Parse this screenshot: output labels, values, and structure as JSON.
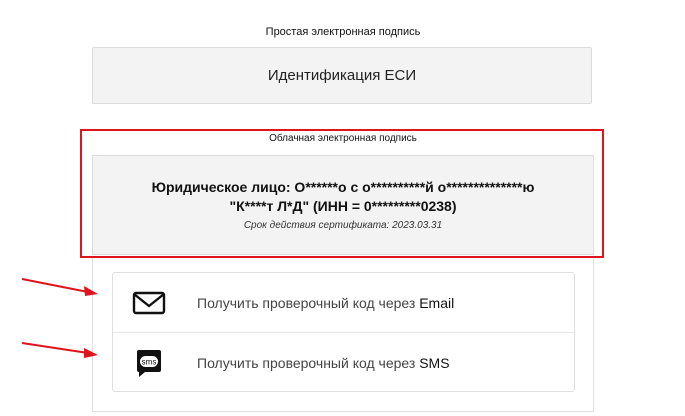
{
  "simple_signature": {
    "label": "Простая электронная подпись",
    "button_label": "Идентификация ЕСИ"
  },
  "cloud_signature": {
    "label": "Облачная электронная подпись",
    "cert_line_1": "Юридическое лицо: О******о с о**********й о**************ю",
    "cert_line_2": "\"К****т Л*Д\" (ИНН = 0*********0238)",
    "validity": "Срок действия сертификата: 2023.03.31"
  },
  "methods": {
    "email": {
      "prefix": "Получить проверочный код через ",
      "channel": "Email",
      "icon": "envelope-icon"
    },
    "sms": {
      "prefix": "Получить проверочный код через ",
      "channel": "SMS",
      "icon": "sms-icon",
      "icon_text": "sms"
    }
  },
  "colors": {
    "highlight": "#e0141c",
    "card_bg": "#f3f3f3"
  }
}
